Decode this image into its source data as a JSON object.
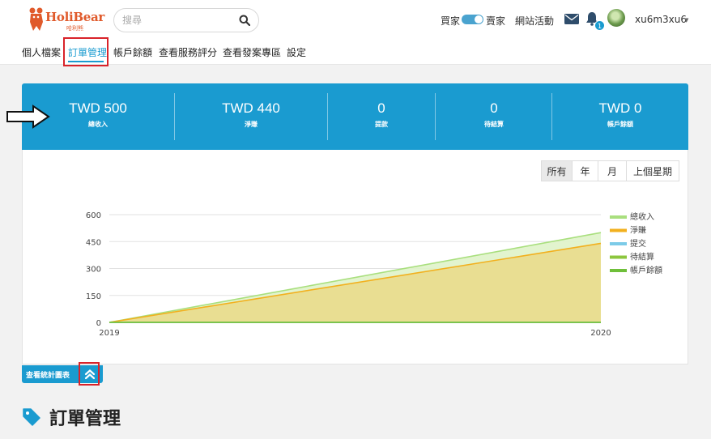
{
  "brand": {
    "name": "HoliBear",
    "subname": "哈利熊",
    "color": "#e05a2b"
  },
  "search": {
    "placeholder": "搜尋",
    "icon": "search-icon"
  },
  "header": {
    "buyer_label": "買家",
    "seller_label": "賣家",
    "activity_label": "網站活動",
    "notification_count": "1",
    "username": "xu6m3xu6"
  },
  "nav": {
    "items": [
      {
        "label": "個人檔案"
      },
      {
        "label": "訂單管理",
        "active": true
      },
      {
        "label": "帳戶餘額"
      },
      {
        "label": "查看服務評分"
      },
      {
        "label": "查看發案專區"
      },
      {
        "label": "設定"
      }
    ]
  },
  "stats": [
    {
      "value": "TWD 500",
      "label": "總收入"
    },
    {
      "value": "TWD 440",
      "label": "淨賺"
    },
    {
      "value": "0",
      "label": "提款"
    },
    {
      "value": "0",
      "label": "待結算"
    },
    {
      "value": "TWD 0",
      "label": "帳戶餘額"
    }
  ],
  "range_buttons": [
    {
      "label": "所有",
      "active": true
    },
    {
      "label": "年"
    },
    {
      "label": "月"
    },
    {
      "label": "上個星期"
    }
  ],
  "chart_data": {
    "type": "area",
    "x": [
      "2019",
      "2020"
    ],
    "ylim": [
      0,
      600
    ],
    "yticks": [
      0,
      150,
      300,
      450,
      600
    ],
    "grid": true,
    "legend_position": "right",
    "series": [
      {
        "name": "總收入",
        "values": [
          0,
          500
        ],
        "color": "#a9df7e"
      },
      {
        "name": "淨賺",
        "values": [
          0,
          440
        ],
        "color": "#f2b01e"
      },
      {
        "name": "提交",
        "values": [
          0,
          0
        ],
        "color": "#7ccbe8"
      },
      {
        "name": "待結算",
        "values": [
          0,
          0
        ],
        "color": "#8cc63e"
      },
      {
        "name": "帳戶餘額",
        "values": [
          0,
          0
        ],
        "color": "#6fbf3a"
      }
    ]
  },
  "chart_toggle": {
    "label": "查看統計圖表",
    "icon": "double-chevron-up-icon"
  },
  "section": {
    "title": "訂單管理",
    "icon": "tag-icon"
  },
  "colors": {
    "accent": "#1a9bd0",
    "highlight": "#d9232a"
  }
}
